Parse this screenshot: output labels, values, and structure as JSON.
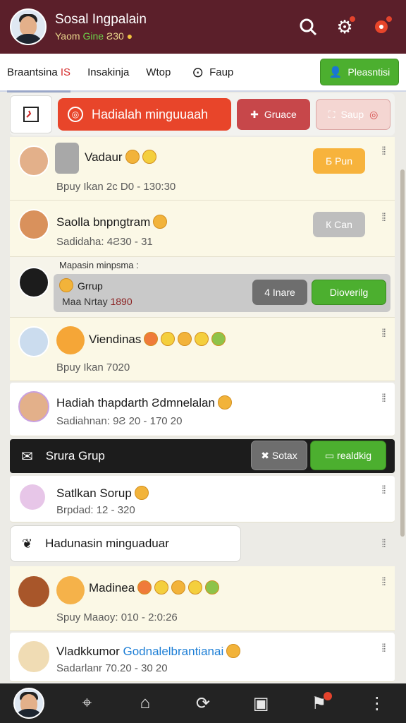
{
  "header": {
    "user_name": "Sosal Ingpalain",
    "user_sub_prefix": "Yaom",
    "user_sub_green": "Gine",
    "user_sub_suffix": "Ƨ30",
    "icons": [
      "search-icon",
      "gear-icon",
      "bell-icon"
    ]
  },
  "tabs": {
    "items": [
      "Braantsina",
      "Insakinja",
      "Wtop"
    ],
    "first_badge": "IS",
    "search_label": "Faup",
    "primary_label": "Pleasntisi"
  },
  "toolbar": {
    "cta_label": "Hadialah minguuaah",
    "btn1_label": "Gruace",
    "btn2_label": "Saup"
  },
  "rows": [
    {
      "title": "Vadaur",
      "sub": "Bpuy Ikan 2c D0 - 130:30",
      "pill": "Б Рun"
    },
    {
      "title": "Saolla bnpngtram",
      "sub": "Sadidaha: 4Ƨ30 - 31",
      "pill": "К Can"
    },
    {
      "header_text": "Mapasin minpsma :",
      "group_title": "Grrup",
      "group_sub": "Maa Nrtay",
      "group_num": "1890",
      "pill1": "4 Inare",
      "pill2": "Dioverilg"
    },
    {
      "title": "Viendinas",
      "sub": "Bpuy Ikan 7020"
    },
    {
      "title": "Hadiah thapdarth Ƨdmnelalan",
      "sub": "Sadiahnan: 9Ƨ 20 - 170 20"
    },
    {
      "banner": "Srura Grup",
      "pill1": "Sotax",
      "pill2": "realdkig"
    },
    {
      "title": "Satlkan Sorup",
      "sub": "Brpdad: 12 - 320"
    },
    {
      "input": "Hadunasin minguaduar"
    },
    {
      "title": "Madinea",
      "sub": "Spuy Maaoy: 010 - 2:0:26"
    },
    {
      "title_prefix": "Vladkkumor",
      "title_blue": "Godnalelbrantianai",
      "sub": "Sadarlanr 70.20 - 30 20"
    }
  ],
  "bottom_nav": [
    "avatar",
    "location-icon",
    "shop-icon",
    "sync-icon",
    "tool-icon",
    "bell-icon",
    "more-icon"
  ]
}
